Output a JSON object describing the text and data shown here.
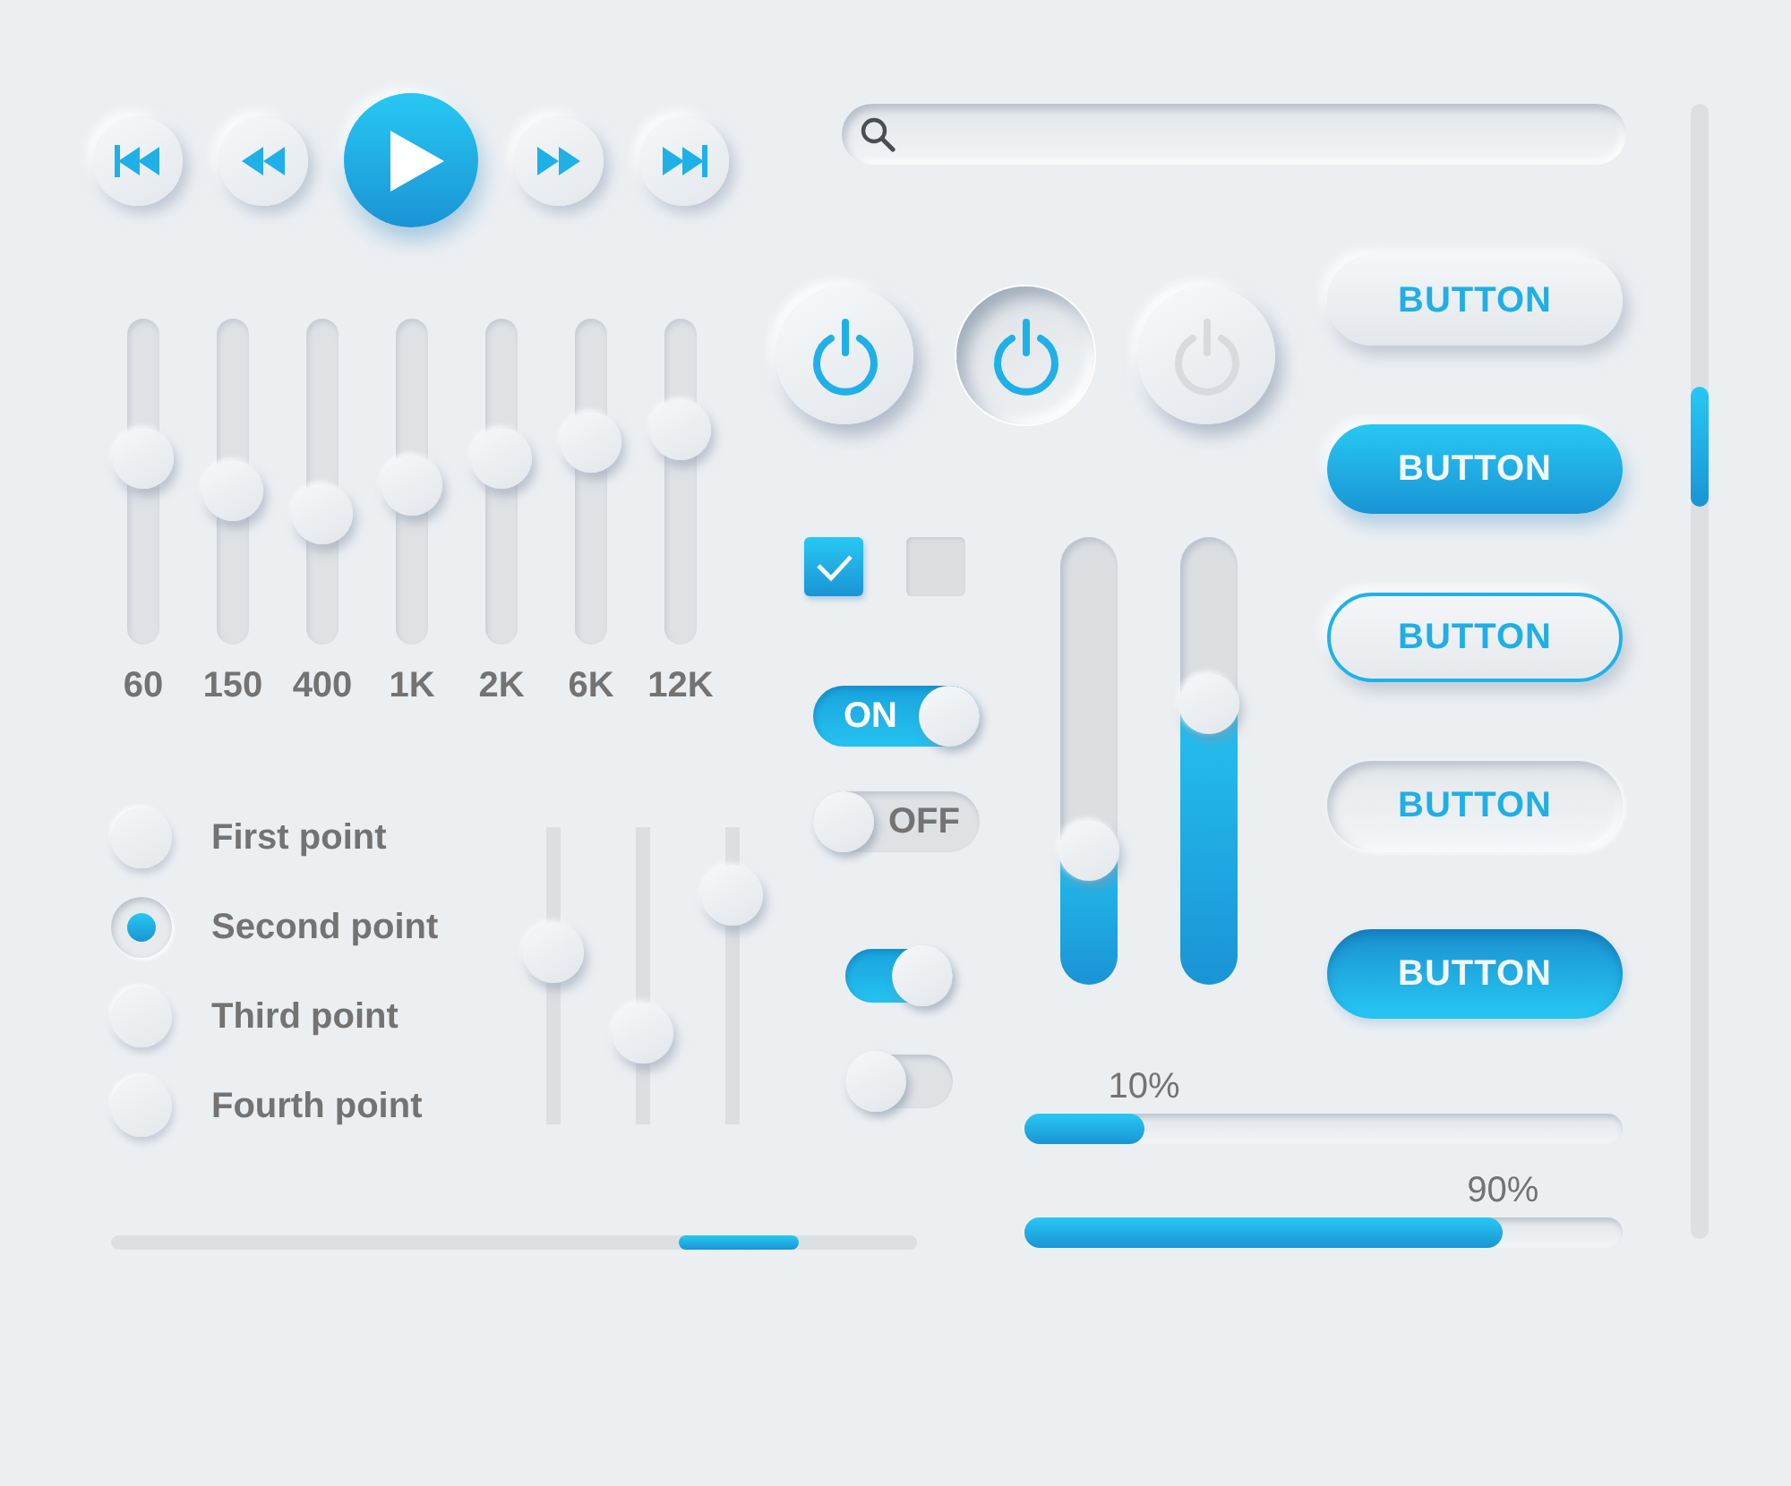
{
  "equalizer": {
    "bands": [
      {
        "label": "60",
        "level": 0.57
      },
      {
        "label": "150",
        "level": 0.47
      },
      {
        "label": "400",
        "level": 0.4
      },
      {
        "label": "1K",
        "level": 0.49
      },
      {
        "label": "2K",
        "level": 0.57
      },
      {
        "label": "6K",
        "level": 0.62
      },
      {
        "label": "12K",
        "level": 0.66
      }
    ]
  },
  "radio_options": [
    {
      "label": "First point",
      "selected": false
    },
    {
      "label": "Second point",
      "selected": true
    },
    {
      "label": "Third point",
      "selected": false
    },
    {
      "label": "Fourth point",
      "selected": false
    }
  ],
  "small_sliders": [
    {
      "level": 0.58
    },
    {
      "level": 0.31
    },
    {
      "level": 0.77
    }
  ],
  "power_buttons": [
    {
      "pressed": false,
      "disabled": false
    },
    {
      "pressed": true,
      "disabled": false
    },
    {
      "pressed": false,
      "disabled": true
    }
  ],
  "checkboxes": [
    {
      "checked": true
    },
    {
      "checked": false
    }
  ],
  "toggles": [
    {
      "kind": "labeled",
      "label": "ON",
      "on": true
    },
    {
      "kind": "labeled",
      "label": "OFF",
      "on": false
    },
    {
      "kind": "plain",
      "on": true
    },
    {
      "kind": "plain",
      "on": false
    }
  ],
  "fill_sliders": [
    {
      "level": 0.3
    },
    {
      "level": 0.63
    }
  ],
  "buttons": [
    {
      "label": "BUTTON",
      "kind": "raised"
    },
    {
      "label": "BUTTON",
      "kind": "primary"
    },
    {
      "label": "BUTTON",
      "kind": "outlined"
    },
    {
      "label": "BUTTON",
      "kind": "inset"
    },
    {
      "label": "BUTTON",
      "kind": "pressed"
    }
  ],
  "progress_bars": [
    {
      "label": "10%",
      "level": 0.2
    },
    {
      "label": "90%",
      "level": 0.8
    }
  ]
}
